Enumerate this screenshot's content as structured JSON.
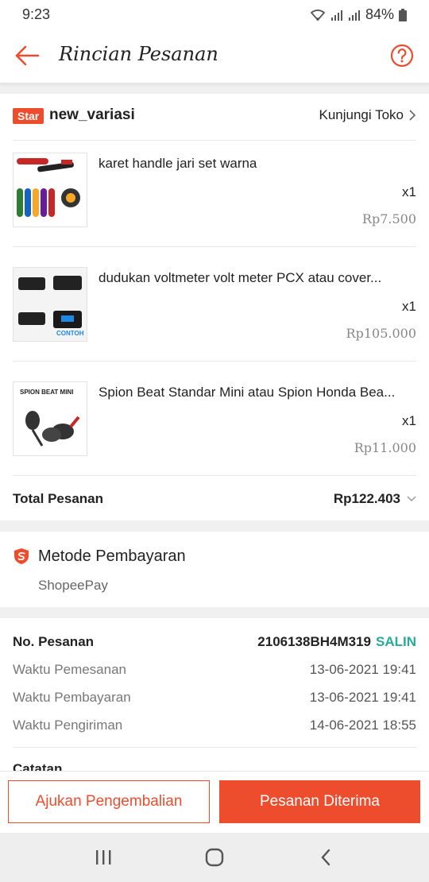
{
  "status_bar": {
    "time": "9:23",
    "battery": "84%"
  },
  "header": {
    "title": "Rincian Pesanan"
  },
  "shop": {
    "badge": "Star",
    "name": "new_variasi",
    "visit_label": "Kunjungi Toko"
  },
  "items": [
    {
      "name": "karet handle jari set warna",
      "qty": "x1",
      "price": "Rp7.500"
    },
    {
      "name": "dudukan voltmeter volt meter PCX atau cover...",
      "qty": "x1",
      "price": "Rp105.000"
    },
    {
      "name": "Spion Beat Standar Mini atau Spion Honda Bea...",
      "qty": "x1",
      "price": "Rp11.000"
    }
  ],
  "thumbs": {
    "item3_caption": "SPION BEAT MINI",
    "item2_caption": "CONTOH"
  },
  "total": {
    "label": "Total Pesanan",
    "value": "Rp122.403"
  },
  "payment": {
    "title": "Metode Pembayaran",
    "value": "ShopeePay"
  },
  "order": {
    "no_label": "No. Pesanan",
    "no_value": "2106138BH4M319",
    "copy_label": "SALIN",
    "rows": [
      {
        "label": "Waktu Pemesanan",
        "value": "13-06-2021 19:41"
      },
      {
        "label": "Waktu Pembayaran",
        "value": "13-06-2021 19:41"
      },
      {
        "label": "Waktu Pengiriman",
        "value": "14-06-2021 18:55"
      }
    ],
    "notes_label": "Catatan"
  },
  "actions": {
    "return_label": "Ajukan Pengembalian",
    "received_label": "Pesanan Diterima"
  },
  "colors": {
    "accent": "#ee4d2d",
    "copy": "#26aa99"
  }
}
